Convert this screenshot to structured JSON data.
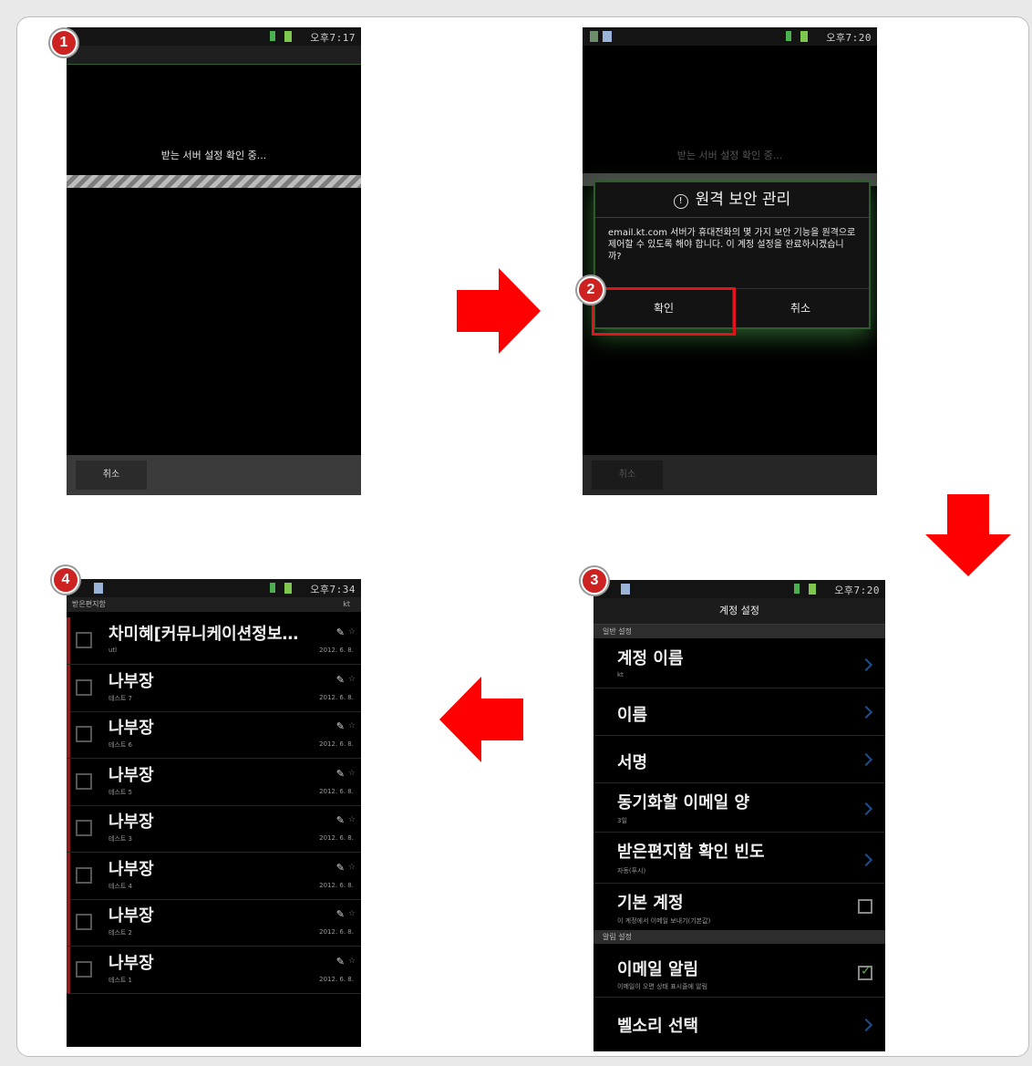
{
  "badges": [
    "1",
    "2",
    "3",
    "4"
  ],
  "screen1": {
    "time": "오후7:17",
    "message": "받는 서버 설정 확인 중...",
    "cancel": "취소"
  },
  "screen2": {
    "time": "오후7:20",
    "dim_message": "받는 서버 설정 확인 중...",
    "dialog_title": "원격 보안 관리",
    "dialog_message": "email.kt.com 서버가 휴대전화의 몇 가지 보안 기능을 원격으로 제어할 수 있도록 해야 합니다. 이 계정 설정을 완료하시겠습니까?",
    "confirm": "확인",
    "cancel_dialog": "취소",
    "cancel": "취소"
  },
  "screen3": {
    "time": "오후7:20",
    "title": "계정 설정",
    "section_general": "일반 설정",
    "section_notify": "알림 설정",
    "rows": [
      {
        "title": "계정 이름",
        "sub": "kt"
      },
      {
        "title": "이름",
        "sub": ""
      },
      {
        "title": "서명",
        "sub": ""
      },
      {
        "title": "동기화할 이메일 양",
        "sub": "3일"
      },
      {
        "title": "받은편지함 확인 빈도",
        "sub": "자동(푸시)"
      },
      {
        "title": "기본 계정",
        "sub": "이 계정에서 이메일 보내기(기본값)"
      },
      {
        "title": "이메일 알림",
        "sub": "이메일이 오면 상태 표시줄에 알림"
      },
      {
        "title": "벨소리 선택",
        "sub": ""
      }
    ]
  },
  "screen4": {
    "time": "오후7:34",
    "header": "받은편지함",
    "header_right": "kt",
    "mails": [
      {
        "sender": "차미혜[커뮤니케이션정보…",
        "subject": "utl",
        "date": "2012. 6. 8."
      },
      {
        "sender": "나부장",
        "subject": "테스트 7",
        "date": "2012. 6. 8."
      },
      {
        "sender": "나부장",
        "subject": "테스트 6",
        "date": "2012. 6. 8."
      },
      {
        "sender": "나부장",
        "subject": "테스트 5",
        "date": "2012. 6. 8."
      },
      {
        "sender": "나부장",
        "subject": "테스트 3",
        "date": "2012. 6. 8."
      },
      {
        "sender": "나부장",
        "subject": "테스트 4",
        "date": "2012. 6. 8."
      },
      {
        "sender": "나부장",
        "subject": "테스트 2",
        "date": "2012. 6. 8."
      },
      {
        "sender": "나부장",
        "subject": "테스트 1",
        "date": "2012. 6. 8."
      }
    ]
  },
  "colors": {
    "arrow": "#ff0000",
    "badge": "#cc2222",
    "highlight": "#e0141a"
  }
}
